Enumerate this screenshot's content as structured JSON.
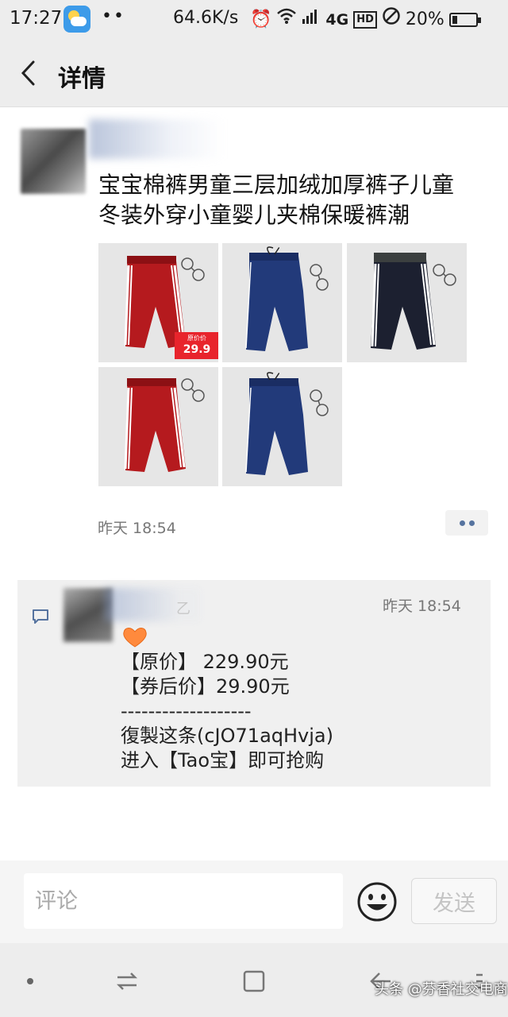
{
  "status_bar": {
    "time": "17:27",
    "extra_dots": "••",
    "net_speed": "64.6K/s",
    "network": "4G",
    "hd": "HD",
    "battery_pct": "20%",
    "battery_level": 0.2
  },
  "header": {
    "title": "详情",
    "back_icon": "chevron-left-icon"
  },
  "post": {
    "text_line1": "宝宝棉裤男童三层加绒加厚裤子儿童",
    "text_line2": "冬装外穿小童婴儿夹棉保暖裤潮",
    "images": [
      {
        "color": "red",
        "price_tag_small": "原价价",
        "price_tag_value": "29.9"
      },
      {
        "color": "navy"
      },
      {
        "color": "black"
      },
      {
        "color": "red"
      },
      {
        "color": "navy"
      }
    ],
    "time": "昨天 18:54"
  },
  "comment": {
    "name_fragment": "乙",
    "time": "昨天 18:54",
    "lines": [
      "【原价】 229.90元",
      "【券后价】29.90元",
      "-------------------",
      "復製这条(cJO71aqHvja)",
      "进入【Tao宝】即可抢购"
    ]
  },
  "input_bar": {
    "placeholder": "评论",
    "send_label": "发送"
  },
  "watermark": "头条 @芬香社交电商",
  "colors": {
    "header_bg": "#ededed",
    "link_blue": "#56739f",
    "price_red": "#e8242c"
  }
}
